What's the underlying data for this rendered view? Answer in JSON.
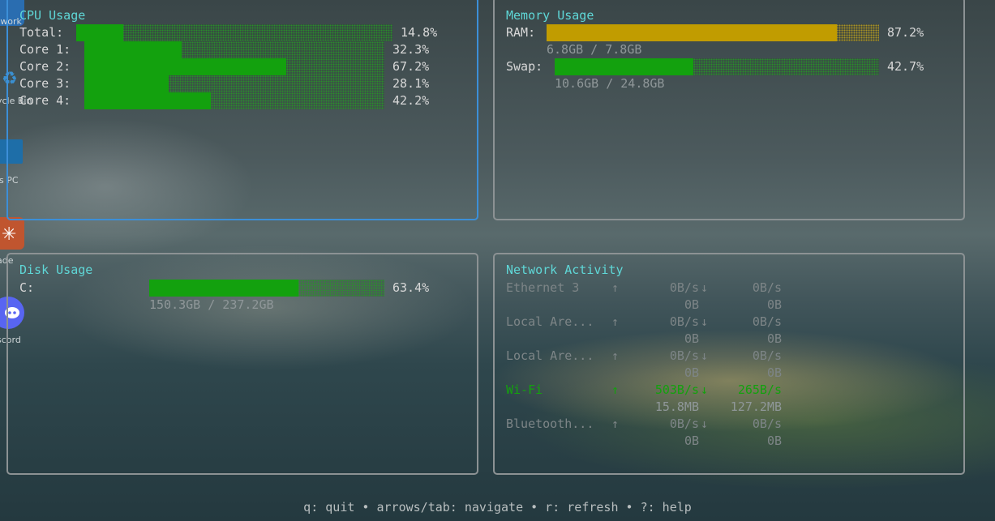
{
  "desktop": {
    "icons": [
      {
        "name": "network-icon",
        "label": "twork"
      },
      {
        "name": "recycle-bin-icon",
        "label": "ycle Bin"
      },
      {
        "name": "this-pc-icon",
        "label": "is PC"
      },
      {
        "name": "app-icon",
        "label": "ade"
      },
      {
        "name": "discord-icon",
        "label": "scord"
      }
    ]
  },
  "cpu": {
    "title": "CPU Usage",
    "rows": [
      {
        "label": "Total:",
        "percent_text": "14.8%",
        "value": 14.8
      },
      {
        "label": "Core 1:",
        "percent_text": "32.3%",
        "value": 32.3
      },
      {
        "label": "Core 2:",
        "percent_text": "67.2%",
        "value": 67.2
      },
      {
        "label": "Core 3:",
        "percent_text": "28.1%",
        "value": 28.1
      },
      {
        "label": "Core 4:",
        "percent_text": "42.2%",
        "value": 42.2
      }
    ]
  },
  "memory": {
    "title": "Memory Usage",
    "ram": {
      "label": "RAM:",
      "percent_text": "87.2%",
      "value": 87.2,
      "detail": "6.8GB / 7.8GB"
    },
    "swap": {
      "label": "Swap:",
      "percent_text": "42.7%",
      "value": 42.7,
      "detail": "10.6GB / 24.8GB"
    }
  },
  "disk": {
    "title": "Disk Usage",
    "drive": {
      "label": "C:",
      "percent_text": "63.4%",
      "value": 63.4,
      "detail": "150.3GB / 237.2GB"
    }
  },
  "network": {
    "title": "Network Activity",
    "up_arrow": "↑",
    "down_arrow": "↓",
    "interfaces": [
      {
        "name": "Ethernet 3",
        "up_rate": "0B/s",
        "down_rate": "0B/s",
        "up_total": "0B",
        "down_total": "0B",
        "active": false
      },
      {
        "name": "Local Are...",
        "up_rate": "0B/s",
        "down_rate": "0B/s",
        "up_total": "0B",
        "down_total": "0B",
        "active": false
      },
      {
        "name": "Local Are...",
        "up_rate": "0B/s",
        "down_rate": "0B/s",
        "up_total": "0B",
        "down_total": "0B",
        "active": false
      },
      {
        "name": "Wi-Fi",
        "up_rate": "503B/s",
        "down_rate": "265B/s",
        "up_total": "15.8MB",
        "down_total": "127.2MB",
        "active": true
      },
      {
        "name": "Bluetooth...",
        "up_rate": "0B/s",
        "down_rate": "0B/s",
        "up_total": "0B",
        "down_total": "0B",
        "active": false
      }
    ]
  },
  "footer": {
    "help_text": "q: quit • arrows/tab: navigate • r: refresh • ?: help"
  },
  "colors": {
    "accent": "#5fd7d7",
    "active_border": "#3c8fd8",
    "bar_green": "#13a10e",
    "bar_yellow": "#c19c00"
  }
}
